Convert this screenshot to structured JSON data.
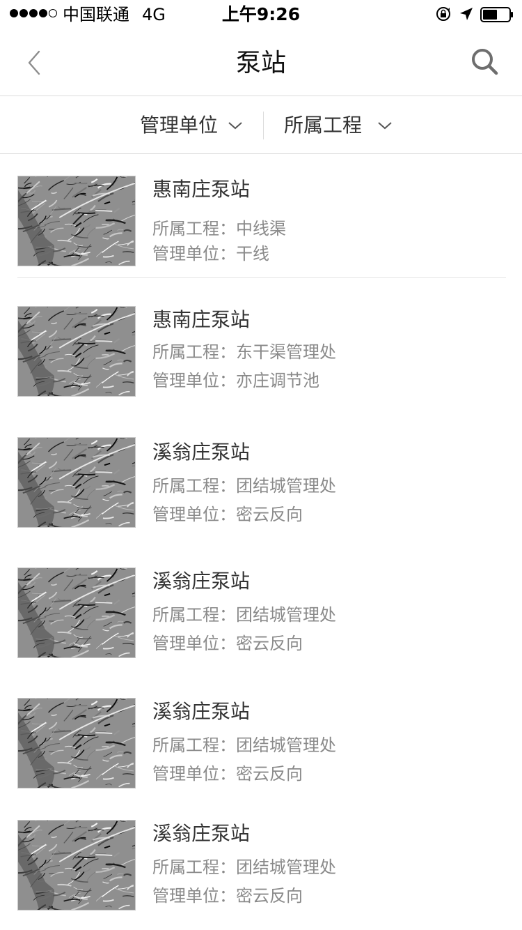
{
  "status_bar": {
    "carrier": "中国联通",
    "network": "4G",
    "time": "上午9:26",
    "signal_strength": "4/5",
    "battery_level": 0.55
  },
  "nav": {
    "title": "泵站",
    "back_icon": "chevron-left-icon",
    "search_icon": "search-icon"
  },
  "filters": {
    "management_unit_label": "管理单位",
    "project_label": "所属工程",
    "dropdown_icon": "chevron-down-icon"
  },
  "labels": {
    "project_prefix": "所属工程：",
    "unit_prefix": "管理单位："
  },
  "stations": [
    {
      "name": "惠南庄泵站",
      "project": "中线渠",
      "unit": "干线"
    },
    {
      "name": "惠南庄泵站",
      "project": "东干渠管理处",
      "unit": "亦庄调节池"
    },
    {
      "name": "溪翁庄泵站",
      "project": "团结城管理处",
      "unit": "密云反向"
    },
    {
      "name": "溪翁庄泵站",
      "project": "团结城管理处",
      "unit": "密云反向"
    },
    {
      "name": "溪翁庄泵站",
      "project": "团结城管理处",
      "unit": "密云反向"
    },
    {
      "name": "溪翁庄泵站",
      "project": "团结城管理处",
      "unit": "密云反向"
    }
  ],
  "colors": {
    "text_primary": "#333333",
    "text_secondary": "#8a8a8a",
    "divider": "#dcdcdc"
  }
}
